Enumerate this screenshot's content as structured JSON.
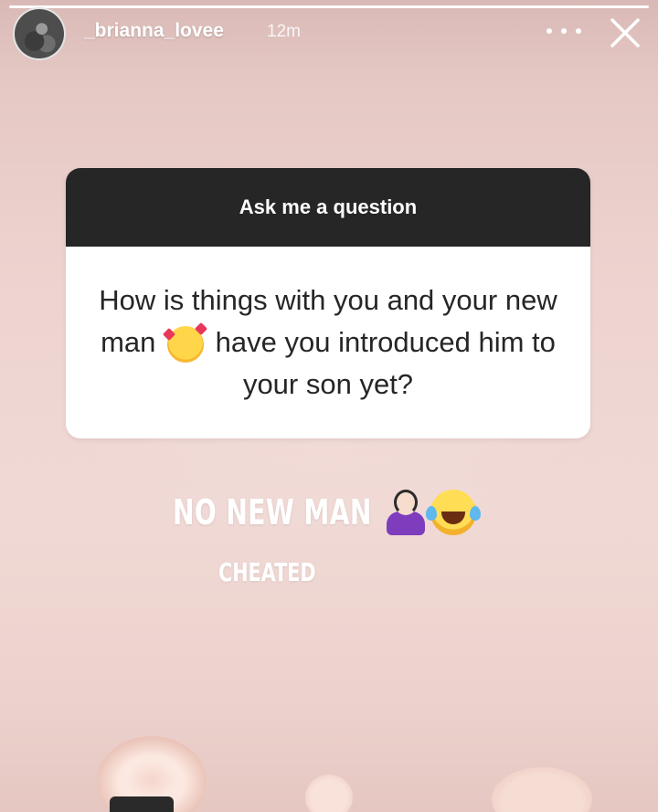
{
  "header": {
    "username": "_brianna_lovee",
    "timestamp": "12m",
    "story_progress": 1.0
  },
  "question_sticker": {
    "title": "Ask me a question",
    "question_part1": "How is things with you and your new man",
    "question_emoji": "smiling-face-with-hearts",
    "question_part2": "have you introduced him to your son yet?"
  },
  "reply": {
    "line1": "NO NEW MAN",
    "line1_emojis": [
      "woman-shrugging",
      "face-with-tears-of-joy"
    ],
    "line2": "CHEATED"
  },
  "colors": {
    "background": "#ead0cd",
    "sticker_header": "#262626",
    "sticker_body": "#ffffff",
    "question_text": "#262626",
    "overlay_text": "#ffffff"
  }
}
